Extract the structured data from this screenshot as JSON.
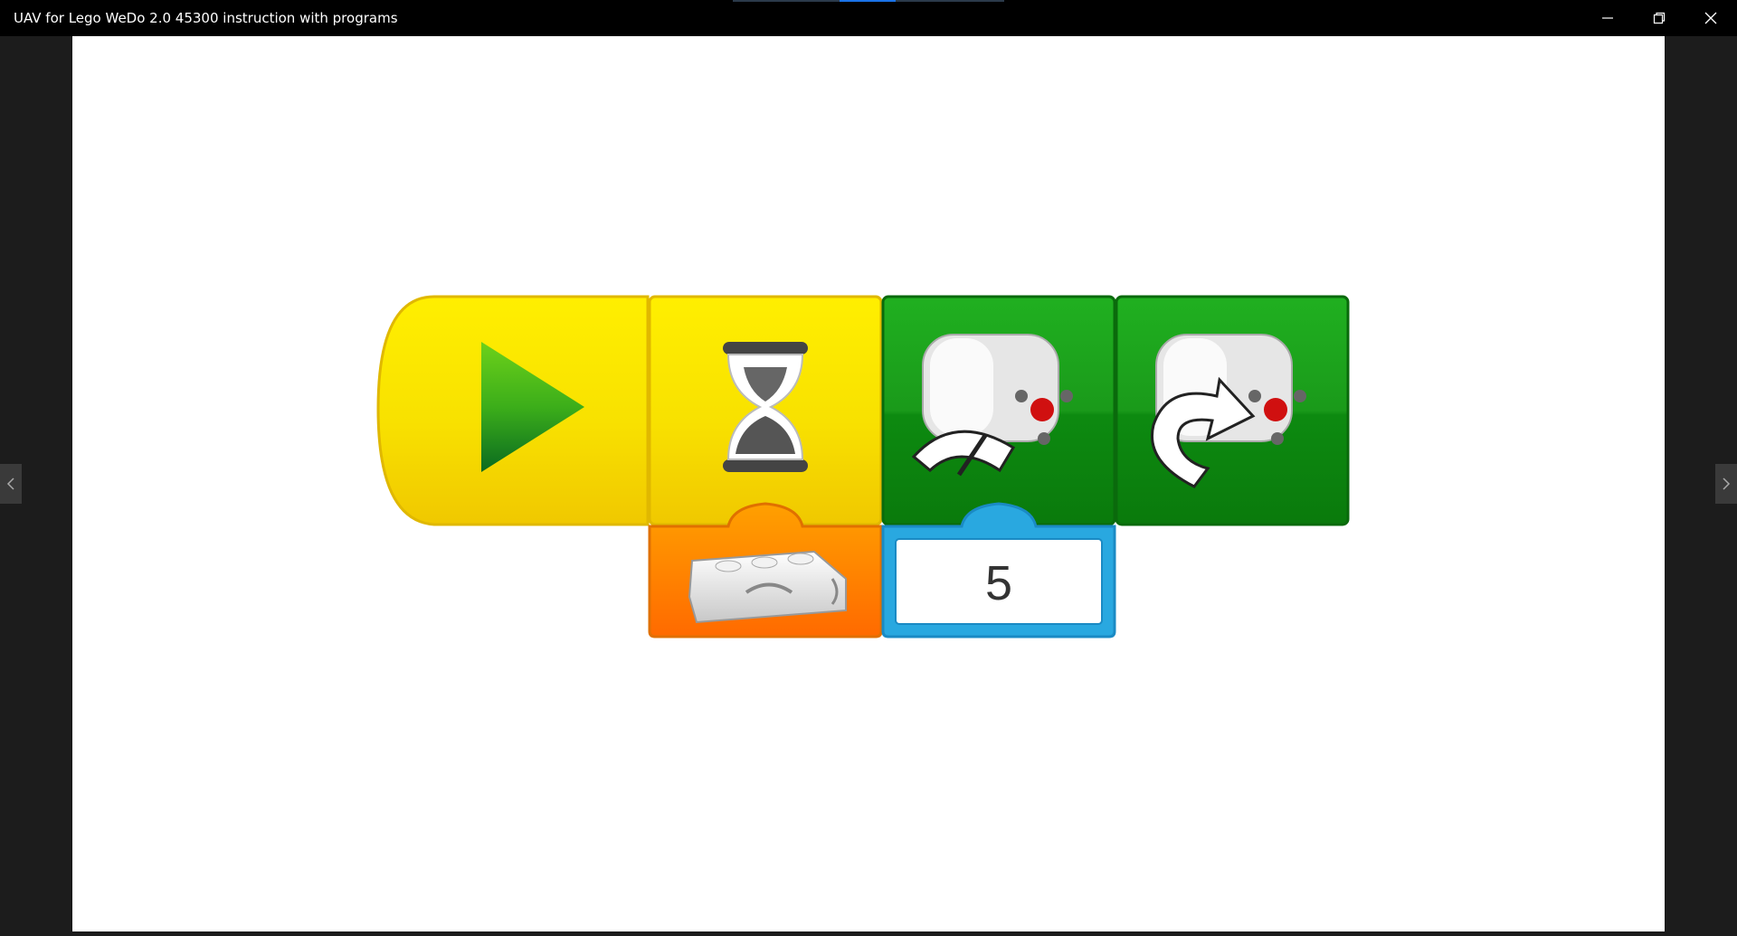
{
  "window": {
    "title": "UAV for Lego WeDo 2.0 45300 instruction with programs",
    "controls": [
      "minimize-icon",
      "restore-icon",
      "close-icon"
    ]
  },
  "viewer": {
    "prev_icon": "chevron-left-icon",
    "next_icon": "chevron-right-icon"
  },
  "program": {
    "blocks": [
      {
        "name": "start-block",
        "icon": "play-icon",
        "color": "#f6e000"
      },
      {
        "name": "wait-block",
        "icon": "hourglass-icon",
        "color": "#f6e000"
      },
      {
        "name": "motor-power-block",
        "icon": "motor-power-icon",
        "color": "#1a9a1a"
      },
      {
        "name": "motor-direction-block",
        "icon": "motor-direction-icon",
        "color": "#1a9a1a"
      }
    ],
    "inputs": [
      {
        "name": "tilt-sensor-input",
        "icon": "tilt-sensor-icon",
        "color": "#ff8a00"
      },
      {
        "name": "number-input",
        "value": "5",
        "color": "#29a8e0"
      }
    ]
  }
}
